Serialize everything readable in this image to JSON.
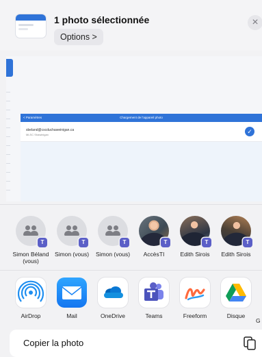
{
  "header": {
    "title": "1 photo sélectionnée",
    "options_label": "Options >",
    "close_glyph": "×"
  },
  "preview": {
    "back_label": "< Paramètres",
    "screen_title": "Chargement de l’appareil photo",
    "email": "sbeland@cscduchaweinigan.ca",
    "subtitle": "MLSC Shawinigan",
    "check_glyph": "✓"
  },
  "people": [
    {
      "name": "Simon Béland (vous)",
      "avatar": "people-icon",
      "badge": "teams"
    },
    {
      "name": "Simon (vous)",
      "avatar": "people-icon",
      "badge": "teams"
    },
    {
      "name": "Simon (vous)",
      "avatar": "people-icon",
      "badge": "teams"
    },
    {
      "name": "AccèsTI",
      "avatar": "photo",
      "badge": "teams"
    },
    {
      "name": "Edith Sirois",
      "avatar": "photo",
      "badge": "teams"
    },
    {
      "name": "Edith Sirois",
      "avatar": "photo",
      "badge": "teams"
    }
  ],
  "apps": [
    {
      "name": "AirDrop",
      "icon": "airdrop-icon"
    },
    {
      "name": "Mail",
      "icon": "mail-icon"
    },
    {
      "name": "OneDrive",
      "icon": "onedrive-icon"
    },
    {
      "name": "Teams",
      "icon": "teams-icon"
    },
    {
      "name": "Freeform",
      "icon": "freeform-icon"
    },
    {
      "name": "Disque",
      "icon": "google-drive-icon"
    },
    {
      "name": "G",
      "icon": "partial-icon"
    }
  ],
  "action": {
    "label": "Copier la photo",
    "icon": "copy-icon"
  },
  "colors": {
    "accent": "#2f73d8",
    "teams": "#5b5fc7",
    "background": "#f2f2f4"
  }
}
